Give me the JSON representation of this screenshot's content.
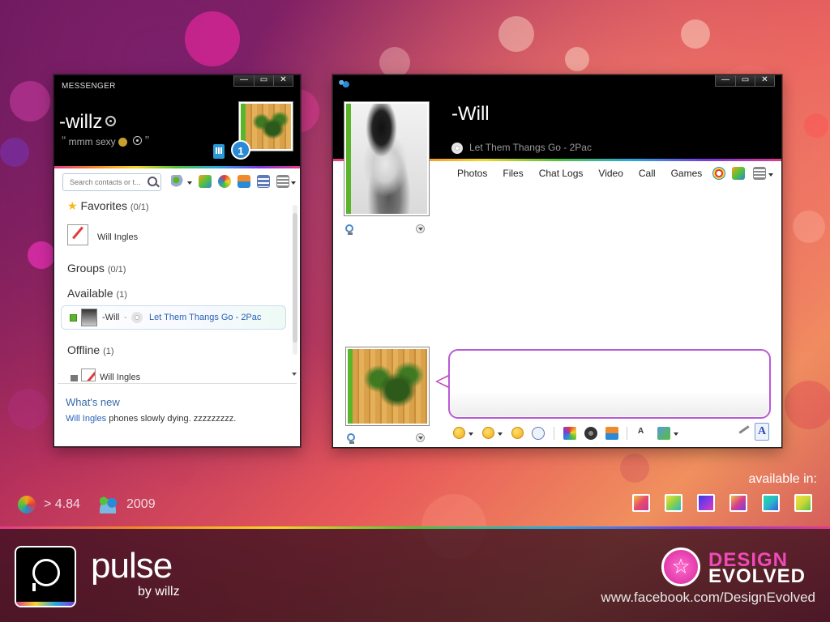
{
  "messenger": {
    "window_label": "MESSENGER",
    "nick": "-willz",
    "psm": "mmm sexy",
    "quote_open": "“",
    "quote_close": "”",
    "badge_count": "1",
    "search_placeholder": "Search contacts or t...",
    "favorites_label": "Favorites",
    "favorites_count": "(0/1)",
    "favorite_contact": "Will Ingles",
    "groups_label": "Groups",
    "groups_count": "(0/1)",
    "available_label": "Available",
    "available_count": "(1)",
    "available_contact_name": "-Will",
    "available_contact_sep": "-",
    "available_contact_song": "Let Them Thangs Go - 2Pac",
    "offline_label": "Offline",
    "offline_count": "(1)",
    "offline_contact": "Will Ingles",
    "whats_new": "What's new",
    "news_link": "Will Ingles",
    "news_text": "phones slowly dying. zzzzzzzzz."
  },
  "chat": {
    "contact_name": "-Will",
    "now_playing": "Let Them Thangs Go - 2Pac",
    "menu": [
      "Photos",
      "Files",
      "Chat Logs",
      "Video",
      "Call",
      "Games"
    ],
    "input_value": ""
  },
  "window_controls": {
    "minimize": "—",
    "maximize": "▭",
    "close": "✕"
  },
  "footer": {
    "version": "> 4.84",
    "year": "2009",
    "available_in": "available in:",
    "app_name": "pulse",
    "by_line": "by willz",
    "brand_top": "DESIGN",
    "brand_bottom": "EVOLVED",
    "url": "www.facebook.com/DesignEvolved"
  },
  "colors": {
    "accent_green": "#5ab52a",
    "link_blue": "#2a62b8",
    "swatches": [
      "#e84a6a",
      "#8ad04a",
      "#8a3ae2",
      "#d6408a",
      "#2ab8c8",
      "#c8d63a"
    ]
  }
}
